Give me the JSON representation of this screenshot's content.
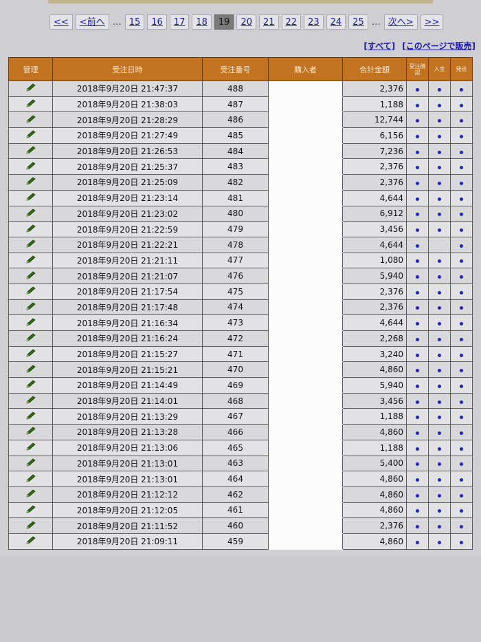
{
  "pager": {
    "first": "<<",
    "prev": "<前へ",
    "ellipsis": "…",
    "pages": [
      "15",
      "16",
      "17",
      "18",
      "19",
      "20",
      "21",
      "22",
      "23",
      "24",
      "25"
    ],
    "current": "19",
    "next": "次へ>",
    "last": ">>"
  },
  "links": {
    "all": "[すべて]",
    "sell_page": "[このページで販売]"
  },
  "table": {
    "headers": {
      "manage": "管理",
      "datetime": "受注日時",
      "order_no": "受注番号",
      "buyer": "購入者",
      "total": "合計金額",
      "confirm": "受注確認",
      "payment": "入金",
      "shipping": "発送"
    },
    "rows": [
      {
        "datetime": "2018年9月20日 21:47:37",
        "order_no": "488",
        "total": "2,376",
        "confirm": true,
        "payment": true,
        "shipping": true
      },
      {
        "datetime": "2018年9月20日 21:38:03",
        "order_no": "487",
        "total": "1,188",
        "confirm": true,
        "payment": true,
        "shipping": true
      },
      {
        "datetime": "2018年9月20日 21:28:29",
        "order_no": "486",
        "total": "12,744",
        "confirm": true,
        "payment": true,
        "shipping": true
      },
      {
        "datetime": "2018年9月20日 21:27:49",
        "order_no": "485",
        "total": "6,156",
        "confirm": true,
        "payment": true,
        "shipping": true
      },
      {
        "datetime": "2018年9月20日 21:26:53",
        "order_no": "484",
        "total": "7,236",
        "confirm": true,
        "payment": true,
        "shipping": true
      },
      {
        "datetime": "2018年9月20日 21:25:37",
        "order_no": "483",
        "total": "2,376",
        "confirm": true,
        "payment": true,
        "shipping": true
      },
      {
        "datetime": "2018年9月20日 21:25:09",
        "order_no": "482",
        "total": "2,376",
        "confirm": true,
        "payment": true,
        "shipping": true
      },
      {
        "datetime": "2018年9月20日 21:23:14",
        "order_no": "481",
        "total": "4,644",
        "confirm": true,
        "payment": true,
        "shipping": true
      },
      {
        "datetime": "2018年9月20日 21:23:02",
        "order_no": "480",
        "total": "6,912",
        "confirm": true,
        "payment": true,
        "shipping": true
      },
      {
        "datetime": "2018年9月20日 21:22:59",
        "order_no": "479",
        "total": "3,456",
        "confirm": true,
        "payment": true,
        "shipping": true
      },
      {
        "datetime": "2018年9月20日 21:22:21",
        "order_no": "478",
        "total": "4,644",
        "confirm": true,
        "payment": false,
        "shipping": true
      },
      {
        "datetime": "2018年9月20日 21:21:11",
        "order_no": "477",
        "total": "1,080",
        "confirm": true,
        "payment": true,
        "shipping": true
      },
      {
        "datetime": "2018年9月20日 21:21:07",
        "order_no": "476",
        "total": "5,940",
        "confirm": true,
        "payment": true,
        "shipping": true
      },
      {
        "datetime": "2018年9月20日 21:17:54",
        "order_no": "475",
        "total": "2,376",
        "confirm": true,
        "payment": true,
        "shipping": true
      },
      {
        "datetime": "2018年9月20日 21:17:48",
        "order_no": "474",
        "total": "2,376",
        "confirm": true,
        "payment": true,
        "shipping": true
      },
      {
        "datetime": "2018年9月20日 21:16:34",
        "order_no": "473",
        "total": "4,644",
        "confirm": true,
        "payment": true,
        "shipping": true
      },
      {
        "datetime": "2018年9月20日 21:16:24",
        "order_no": "472",
        "total": "2,268",
        "confirm": true,
        "payment": true,
        "shipping": true
      },
      {
        "datetime": "2018年9月20日 21:15:27",
        "order_no": "471",
        "total": "3,240",
        "confirm": true,
        "payment": true,
        "shipping": true
      },
      {
        "datetime": "2018年9月20日 21:15:21",
        "order_no": "470",
        "total": "4,860",
        "confirm": true,
        "payment": true,
        "shipping": true
      },
      {
        "datetime": "2018年9月20日 21:14:49",
        "order_no": "469",
        "total": "5,940",
        "confirm": true,
        "payment": true,
        "shipping": true
      },
      {
        "datetime": "2018年9月20日 21:14:01",
        "order_no": "468",
        "total": "3,456",
        "confirm": true,
        "payment": true,
        "shipping": true
      },
      {
        "datetime": "2018年9月20日 21:13:29",
        "order_no": "467",
        "total": "1,188",
        "confirm": true,
        "payment": true,
        "shipping": true
      },
      {
        "datetime": "2018年9月20日 21:13:28",
        "order_no": "466",
        "total": "4,860",
        "confirm": true,
        "payment": true,
        "shipping": true
      },
      {
        "datetime": "2018年9月20日 21:13:06",
        "order_no": "465",
        "total": "1,188",
        "confirm": true,
        "payment": true,
        "shipping": true
      },
      {
        "datetime": "2018年9月20日 21:13:01",
        "order_no": "463",
        "total": "5,400",
        "confirm": true,
        "payment": true,
        "shipping": true
      },
      {
        "datetime": "2018年9月20日 21:13:01",
        "order_no": "464",
        "total": "4,860",
        "confirm": true,
        "payment": true,
        "shipping": true
      },
      {
        "datetime": "2018年9月20日 21:12:12",
        "order_no": "462",
        "total": "4,860",
        "confirm": true,
        "payment": true,
        "shipping": true
      },
      {
        "datetime": "2018年9月20日 21:12:05",
        "order_no": "461",
        "total": "4,860",
        "confirm": true,
        "payment": true,
        "shipping": true
      },
      {
        "datetime": "2018年9月20日 21:11:52",
        "order_no": "460",
        "total": "2,376",
        "confirm": true,
        "payment": true,
        "shipping": true
      },
      {
        "datetime": "2018年9月20日 21:09:11",
        "order_no": "459",
        "total": "4,860",
        "confirm": true,
        "payment": true,
        "shipping": true
      }
    ]
  },
  "icons": {
    "edit": "pencil-icon",
    "status": "dot-icon"
  },
  "colors": {
    "header": "#c2731f",
    "link": "#1a1aa0",
    "dot": "#1e22c8",
    "pencil": "#2f6b14"
  }
}
